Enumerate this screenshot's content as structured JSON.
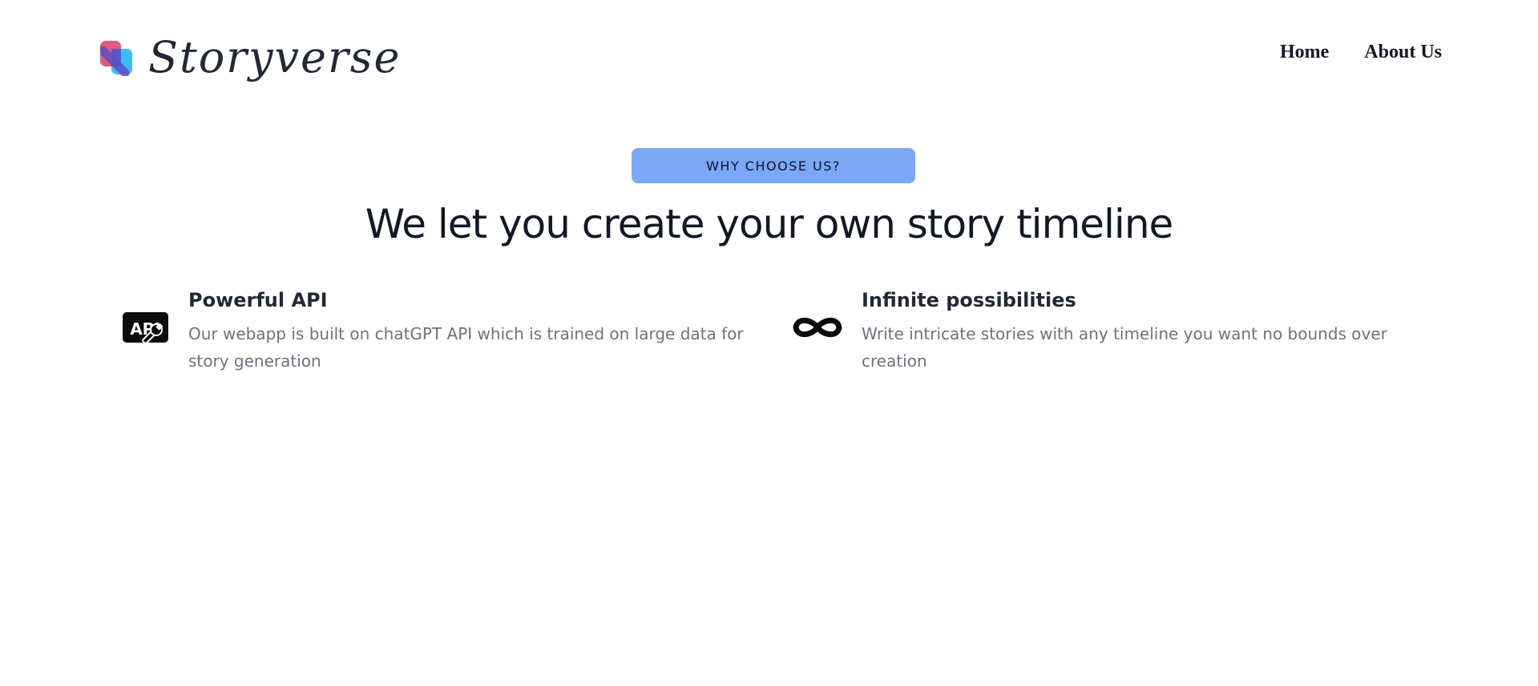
{
  "header": {
    "brand": "Storyverse",
    "nav": [
      {
        "label": "Home"
      },
      {
        "label": "About Us"
      }
    ]
  },
  "section": {
    "badge": "WHY CHOOSE US?",
    "headline": "We let you create your own story timeline",
    "features": [
      {
        "icon": "api-icon",
        "title": "Powerful API",
        "description": "Our webapp is built on chatGPT API which is trained on large data for story generation"
      },
      {
        "icon": "infinity-icon",
        "title": "Infinite possibilities",
        "description": "Write intricate stories with any timeline you want no bounds over creation"
      }
    ]
  },
  "colors": {
    "badge": "#7aa8f7",
    "logo_pink": "#e85a7a",
    "logo_blue": "#38bdf8",
    "logo_violet": "#5b4ec6",
    "heading": "#111827",
    "muted": "#6b7280"
  }
}
